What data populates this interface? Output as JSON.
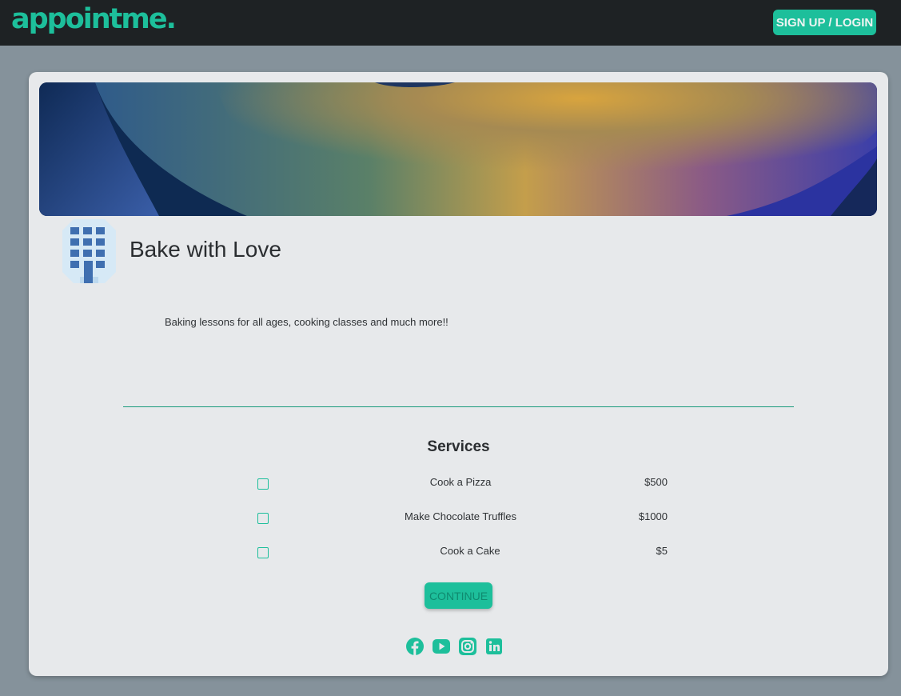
{
  "header": {
    "logo_text": "appointme.",
    "signup_label": "SIGN UP / LOGIN"
  },
  "business": {
    "name": "Bake with Love",
    "description": "Baking lessons for all ages, cooking classes and much more!!"
  },
  "services": {
    "title": "Services",
    "items": [
      {
        "name": "Cook a Pizza",
        "price": "$500",
        "checked": false
      },
      {
        "name": "Make Chocolate Truffles",
        "price": "$1000",
        "checked": false
      },
      {
        "name": "Cook a Cake",
        "price": "$5",
        "checked": false
      }
    ]
  },
  "continue_label": "CONTINUE",
  "social_icons": [
    "facebook-icon",
    "youtube-icon",
    "instagram-icon",
    "linkedin-icon"
  ],
  "colors": {
    "accent": "#1dbf9b",
    "topbar": "#1e2224",
    "page_background": "#85929b",
    "card_background": "#e7e9eb"
  }
}
